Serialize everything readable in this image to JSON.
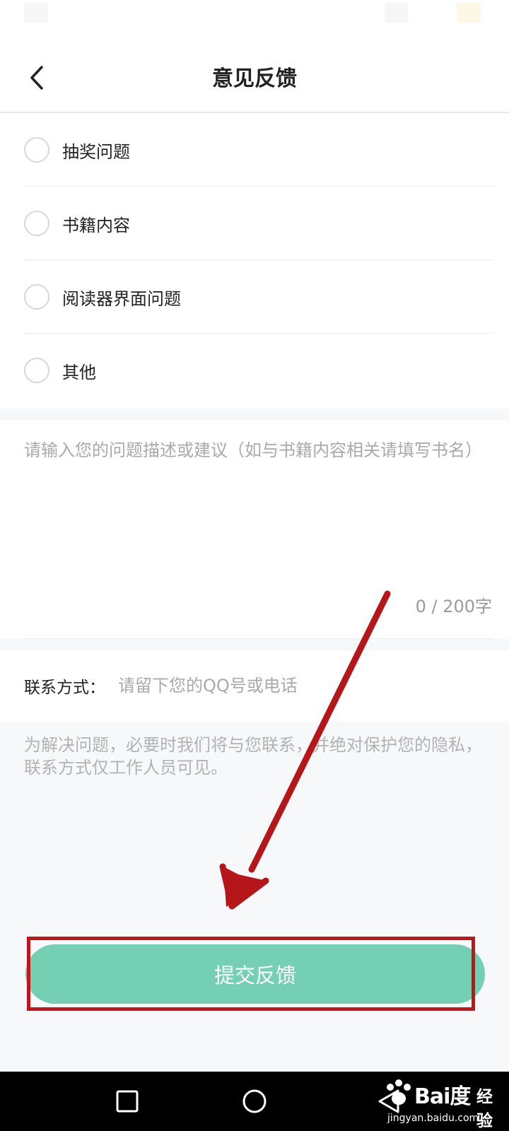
{
  "header": {
    "title": "意见反馈"
  },
  "options": [
    {
      "label": "抽奖问题"
    },
    {
      "label": "书籍内容"
    },
    {
      "label": "阅读器界面问题"
    },
    {
      "label": "其他"
    }
  ],
  "description": {
    "value": "",
    "placeholder": "请输入您的问题描述或建议（如与书籍内容相关请填写书名）",
    "char_count": "0 / 200字"
  },
  "contact": {
    "label": "联系方式：",
    "value": "",
    "placeholder": "请留下您的QQ号或电话"
  },
  "privacy_note": "为解决问题，必要时我们将与您联系，并绝对保护您的隐私，联系方式仅工作人员可见。",
  "submit": {
    "label": "提交反馈"
  },
  "watermark": {
    "logo": "Bai度",
    "product": "经验",
    "url": "jingyan.baidu.com"
  },
  "colors": {
    "accent": "#74cfb3",
    "annotation": "#c0151a",
    "page_bg": "#f7f8fa"
  },
  "icons": {
    "back": "chevron-left-icon",
    "nav_recent": "square-icon",
    "nav_home": "circle-icon",
    "nav_back": "triangle-icon"
  }
}
